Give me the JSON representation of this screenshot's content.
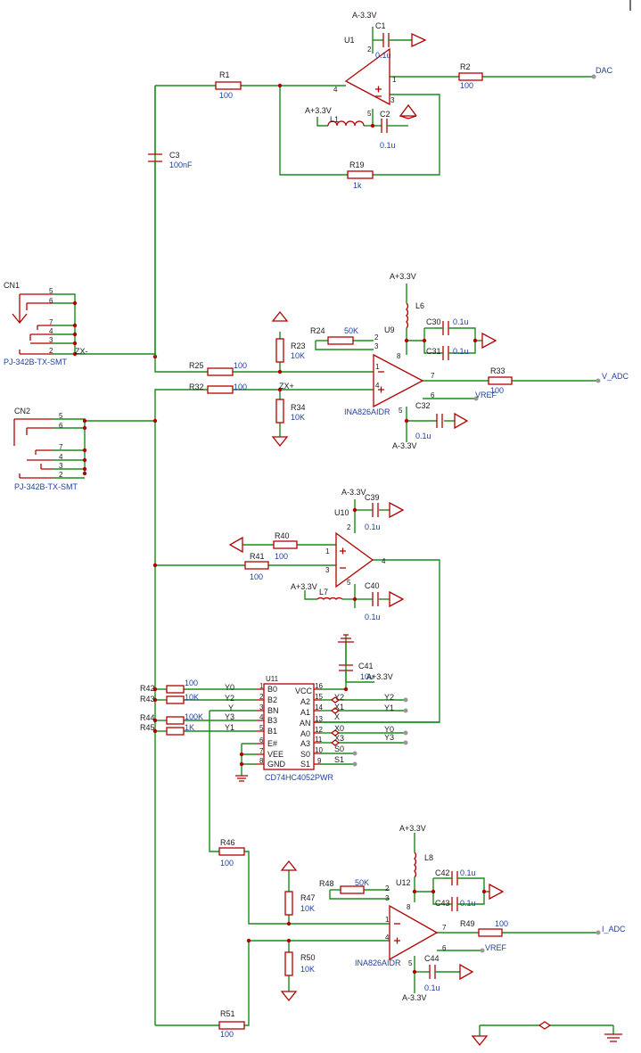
{
  "nets": {
    "dac": "DAC",
    "v_adc": "V_ADC",
    "i_adc": "I_ADC",
    "zx_minus": "ZX-",
    "zx_plus": "ZX+",
    "vref": "VREF",
    "vpos": "A+3.3V",
    "vneg": "A-3.3V",
    "y0": "Y0",
    "y1": "Y1",
    "y2": "Y2",
    "y3": "Y3",
    "y": "Y",
    "x": "X",
    "x0": "X0",
    "x1": "X1",
    "x3": "X3",
    "s0": "S0",
    "s1": "S1"
  },
  "connectors": [
    {
      "ref": "CN1",
      "part": "PJ-342B-TX-SMT",
      "pins": [
        "5",
        "6",
        "7",
        "4",
        "3",
        "2"
      ]
    },
    {
      "ref": "CN2",
      "part": "PJ-342B-TX-SMT",
      "pins": [
        "5",
        "6",
        "7",
        "4",
        "3",
        "2"
      ]
    }
  ],
  "opamps": [
    {
      "ref": "U1",
      "pins": [
        "4",
        "2",
        "1",
        "5",
        "3"
      ]
    },
    {
      "ref": "U10",
      "pins": [
        "1",
        "3",
        "2",
        "4",
        "5"
      ]
    }
  ],
  "inamps": [
    {
      "ref": "U9",
      "part": "INA826AIDR",
      "pins": [
        "1",
        "4",
        "2",
        "3",
        "8",
        "7",
        "6",
        "5"
      ]
    },
    {
      "ref": "U12",
      "part": "INA826AIDR",
      "pins": [
        "1",
        "4",
        "2",
        "3",
        "8",
        "7",
        "6",
        "5"
      ]
    }
  ],
  "mux": {
    "ref": "U11",
    "part": "CD74HC4052PWR",
    "left_pins": [
      {
        "num": "1",
        "name": "B0"
      },
      {
        "num": "2",
        "name": "B2"
      },
      {
        "num": "3",
        "name": "BN"
      },
      {
        "num": "4",
        "name": "B3"
      },
      {
        "num": "5",
        "name": "B1"
      },
      {
        "num": "6",
        "name": "E#"
      },
      {
        "num": "7",
        "name": "VEE"
      },
      {
        "num": "8",
        "name": "GND"
      }
    ],
    "right_pins": [
      {
        "num": "16",
        "name": "VCC"
      },
      {
        "num": "15",
        "name": "A2"
      },
      {
        "num": "14",
        "name": "A1"
      },
      {
        "num": "13",
        "name": "AN"
      },
      {
        "num": "12",
        "name": "A0"
      },
      {
        "num": "11",
        "name": "A3"
      },
      {
        "num": "10",
        "name": "S0"
      },
      {
        "num": "9",
        "name": "S1"
      }
    ]
  },
  "components": {
    "r1": {
      "ref": "R1",
      "val": "100"
    },
    "r2": {
      "ref": "R2",
      "val": "100"
    },
    "r19": {
      "ref": "R19",
      "val": "1k"
    },
    "c1": {
      "ref": "C1",
      "val": "0.1u"
    },
    "c2": {
      "ref": "C2",
      "val": "0.1u"
    },
    "c3": {
      "ref": "C3",
      "val": "100nF"
    },
    "l1": {
      "ref": "L1"
    },
    "r23": {
      "ref": "R23",
      "val": "10K"
    },
    "r24": {
      "ref": "R24",
      "val": "50K"
    },
    "r25": {
      "ref": "R25",
      "val": "100"
    },
    "r32": {
      "ref": "R32",
      "val": "100"
    },
    "r33": {
      "ref": "R33",
      "val": "100"
    },
    "r34": {
      "ref": "R34",
      "val": "10K"
    },
    "l6": {
      "ref": "L6"
    },
    "c30": {
      "ref": "C30",
      "val": "0.1u"
    },
    "c31": {
      "ref": "C31",
      "val": "0.1u"
    },
    "c32": {
      "ref": "C32",
      "val": "0.1u"
    },
    "c39": {
      "ref": "C39",
      "val": "0.1u"
    },
    "c40": {
      "ref": "C40",
      "val": "0.1u"
    },
    "c41": {
      "ref": "C41",
      "val": "10u"
    },
    "r40": {
      "ref": "R40",
      "val": "100"
    },
    "r41": {
      "ref": "R41",
      "val": "100"
    },
    "l7": {
      "ref": "L7"
    },
    "r42": {
      "ref": "R42",
      "val": "100"
    },
    "r43": {
      "ref": "R43",
      "val": "10K"
    },
    "r44": {
      "ref": "R44",
      "val": "100K"
    },
    "r45": {
      "ref": "R45",
      "val": "1K"
    },
    "r46": {
      "ref": "R46",
      "val": "100"
    },
    "r47": {
      "ref": "R47",
      "val": "10K"
    },
    "r48": {
      "ref": "R48",
      "val": "50K"
    },
    "r49": {
      "ref": "R49",
      "val": "100"
    },
    "r50": {
      "ref": "R50",
      "val": "10K"
    },
    "r51": {
      "ref": "R51",
      "val": "100"
    },
    "l8": {
      "ref": "L8"
    },
    "c42": {
      "ref": "C42",
      "val": "0.1u"
    },
    "c43": {
      "ref": "C43",
      "val": "0.1u"
    },
    "c44": {
      "ref": "C44",
      "val": "0.1u"
    }
  },
  "colors": {
    "wire": "#1a8c1a",
    "part": "#b30000",
    "value_text": "#1f3f9f"
  }
}
